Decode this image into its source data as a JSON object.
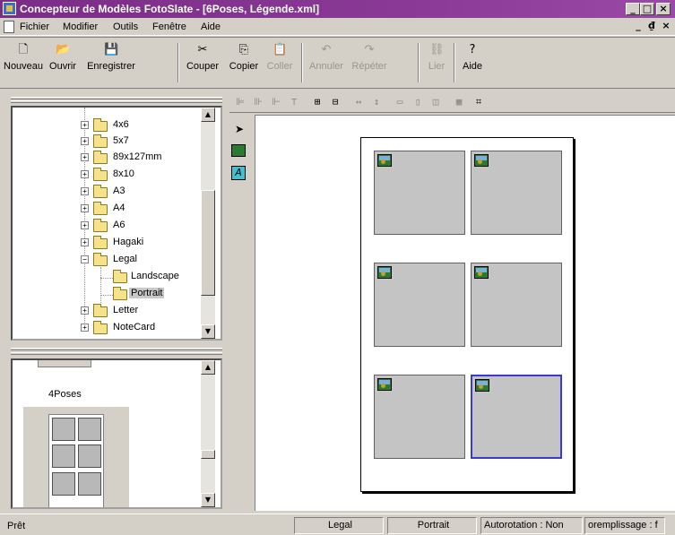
{
  "window": {
    "title": "Concepteur de Modèles FotoSlate - [6Poses, Légende.xml]",
    "buttons": {
      "minimize": "_",
      "maximize": "□",
      "close": "×"
    }
  },
  "menu": {
    "items": [
      "Fichier",
      "Modifier",
      "Outils",
      "Fenêtre",
      "Aide"
    ],
    "mdi": {
      "minimize": "_",
      "restore": "₫",
      "close": "×"
    }
  },
  "toolbar": {
    "buttons": [
      {
        "label": "Nouveau",
        "icon": "new-document-icon",
        "enabled": true
      },
      {
        "label": "Ouvrir",
        "icon": "open-folder-icon",
        "enabled": true
      },
      {
        "label": "Enregistrer",
        "icon": "save-disk-icon",
        "enabled": true
      },
      {
        "label": "Couper",
        "icon": "scissors-icon",
        "enabled": true
      },
      {
        "label": "Copier",
        "icon": "copy-icon",
        "enabled": true
      },
      {
        "label": "Coller",
        "icon": "paste-icon",
        "enabled": false
      },
      {
        "label": "Annuler",
        "icon": "undo-icon",
        "enabled": false
      },
      {
        "label": "Répéter",
        "icon": "redo-icon",
        "enabled": false
      },
      {
        "label": "Lier",
        "icon": "link-icon",
        "enabled": false
      },
      {
        "label": "Aide",
        "icon": "help-icon",
        "enabled": true
      }
    ]
  },
  "tree": {
    "items": [
      {
        "label": "4x6",
        "expander": "+"
      },
      {
        "label": "5x7",
        "expander": "+"
      },
      {
        "label": "89x127mm",
        "expander": "+"
      },
      {
        "label": "8x10",
        "expander": "+"
      },
      {
        "label": "A3",
        "expander": "+"
      },
      {
        "label": "A4",
        "expander": "+"
      },
      {
        "label": "A6",
        "expander": "+"
      },
      {
        "label": "Hagaki",
        "expander": "+"
      },
      {
        "label": "Legal",
        "expander": "−"
      },
      {
        "label": "Landscape",
        "expander": ""
      },
      {
        "label": "Portrait",
        "expander": ""
      },
      {
        "label": "Letter",
        "expander": "+"
      },
      {
        "label": "NoteCard",
        "expander": "+"
      }
    ],
    "selected": "Portrait"
  },
  "preview": {
    "label": "4Poses"
  },
  "tools": [
    "pointer-arrow-icon",
    "image-frame-icon",
    "text-frame-icon"
  ],
  "align_bar": {
    "icons": [
      "align-left-icon",
      "align-center-h-icon",
      "align-right-icon",
      "align-top-icon",
      "group-icon",
      "ungroup-icon",
      "space-horizontal-icon",
      "space-vertical-icon",
      "same-width-icon",
      "same-height-icon",
      "same-size-icon",
      "grid-icon",
      "crop-frame-icon"
    ]
  },
  "layout": {
    "cells": 6,
    "selected_cell": 6
  },
  "status": {
    "ready": "Prêt",
    "paper": "Legal",
    "orientation": "Portrait",
    "autorotation": "Autorotation : Non",
    "fill": "oremplissage : f"
  }
}
